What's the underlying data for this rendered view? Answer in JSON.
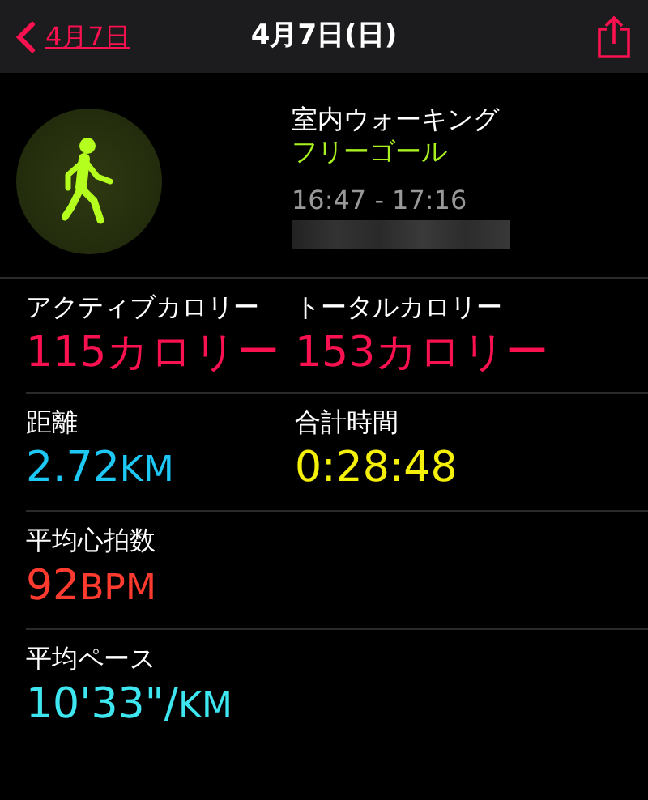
{
  "nav": {
    "back_label": "4月7日",
    "title": "4月7日(日)"
  },
  "workout": {
    "name": "室内ウォーキング",
    "goal": "フリーゴール",
    "time_range": "16:47 - 17:16"
  },
  "metric_rows": [
    {
      "metrics": [
        {
          "label": "アクティブカロリー",
          "value": "115カロリー",
          "color": "#fa1150"
        },
        {
          "label": "トータルカロリー",
          "value": "153カロリー",
          "color": "#fa1150"
        }
      ]
    },
    {
      "metrics": [
        {
          "label": "距離",
          "value": "2.72",
          "unit": "KM",
          "color": "#1ec8f5"
        },
        {
          "label": "合計時間",
          "value": "0:28:48",
          "color": "#f5f00a"
        }
      ]
    },
    {
      "metrics": [
        {
          "label": "平均心拍数",
          "value": "92",
          "unit": "BPM",
          "color": "#ff3b2f"
        }
      ]
    },
    {
      "metrics": [
        {
          "label": "平均ペース",
          "value": "10'33\"/",
          "unit": "KM",
          "color": "#3ee6f0"
        }
      ]
    }
  ]
}
